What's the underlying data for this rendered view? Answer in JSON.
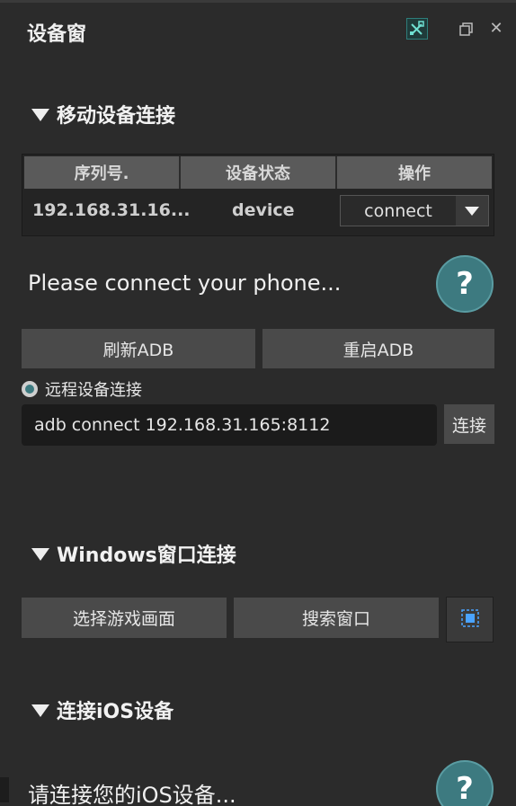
{
  "window": {
    "title": "设备窗"
  },
  "mobile_section": {
    "header": "移动设备连接",
    "table": {
      "columns": [
        "序列号.",
        "设备状态",
        "操作"
      ],
      "rows": [
        {
          "serial": "192.168.31.16...",
          "status": "device",
          "action": "connect"
        }
      ]
    },
    "hint": "Please connect your phone...",
    "help_label": "?",
    "refresh_button": "刷新ADB",
    "restart_button": "重启ADB",
    "remote_label": "远程设备连接",
    "remote_input_value": "adb connect 192.168.31.165:8112",
    "connect_button": "连接"
  },
  "windows_section": {
    "header": "Windows窗口连接",
    "select_button": "选择游戏画面",
    "search_button": "搜索窗口"
  },
  "ios_section": {
    "header": "连接iOS设备",
    "hint": "请连接您的iOS设备...",
    "help_label": "?"
  },
  "colors": {
    "background": "#2b2b2b",
    "accent": "#3d7a80",
    "button": "#4a4a4a",
    "table_header": "#5a5a5a"
  },
  "icons": {
    "tool": "tools-icon",
    "restore": "restore-window-icon",
    "close": "close-icon",
    "capture": "capture-region-icon"
  }
}
